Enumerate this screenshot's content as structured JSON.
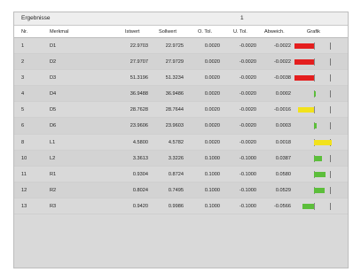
{
  "panel": {
    "title": "Ergebnisse",
    "page_number": "1"
  },
  "columns": {
    "nr": "Nr.",
    "merkmal": "Merkmal",
    "istwert": "Istwert",
    "sollwert": "Sollwert",
    "o_tol": "O. Tol.",
    "u_tol": "U. Tol.",
    "abweich": "Abweich.",
    "grafik": "Grafik"
  },
  "rows": [
    {
      "nr": "1",
      "merkmal": "D1",
      "istwert": "22.9703",
      "sollwert": "22.9725",
      "o_tol": "0.0020",
      "u_tol": "-0.0020",
      "abweich": "-0.0022",
      "status": "red",
      "direction": "left",
      "fill": 1.0
    },
    {
      "nr": "2",
      "merkmal": "D2",
      "istwert": "27.9707",
      "sollwert": "27.9729",
      "o_tol": "0.0020",
      "u_tol": "-0.0020",
      "abweich": "-0.0022",
      "status": "red",
      "direction": "left",
      "fill": 1.0
    },
    {
      "nr": "3",
      "merkmal": "D3",
      "istwert": "51.3196",
      "sollwert": "51.3234",
      "o_tol": "0.0020",
      "u_tol": "-0.0020",
      "abweich": "-0.0038",
      "status": "red",
      "direction": "left",
      "fill": 1.0
    },
    {
      "nr": "4",
      "merkmal": "D4",
      "istwert": "36.9488",
      "sollwert": "36.9486",
      "o_tol": "0.0020",
      "u_tol": "-0.0020",
      "abweich": "0.0002",
      "status": "green",
      "direction": "right",
      "fill": 0.1
    },
    {
      "nr": "5",
      "merkmal": "D5",
      "istwert": "28.7628",
      "sollwert": "28.7644",
      "o_tol": "0.0020",
      "u_tol": "-0.0020",
      "abweich": "-0.0016",
      "status": "yellow",
      "direction": "left",
      "fill": 0.8
    },
    {
      "nr": "6",
      "merkmal": "D6",
      "istwert": "23.9606",
      "sollwert": "23.9603",
      "o_tol": "0.0020",
      "u_tol": "-0.0020",
      "abweich": "0.0003",
      "status": "green",
      "direction": "right",
      "fill": 0.15
    },
    {
      "nr": "8",
      "merkmal": "L1",
      "istwert": "4.5800",
      "sollwert": "4.5782",
      "o_tol": "0.0020",
      "u_tol": "-0.0020",
      "abweich": "0.0018",
      "status": "yellow",
      "direction": "right",
      "fill": 0.9
    },
    {
      "nr": "10",
      "merkmal": "L2",
      "istwert": "3.3613",
      "sollwert": "3.3226",
      "o_tol": "0.1000",
      "u_tol": "-0.1000",
      "abweich": "0.0387",
      "status": "green",
      "direction": "right",
      "fill": 0.39
    },
    {
      "nr": "11",
      "merkmal": "R1",
      "istwert": "0.9304",
      "sollwert": "0.8724",
      "o_tol": "0.1000",
      "u_tol": "-0.1000",
      "abweich": "0.0580",
      "status": "green",
      "direction": "right",
      "fill": 0.58
    },
    {
      "nr": "12",
      "merkmal": "R2",
      "istwert": "0.8024",
      "sollwert": "0.7495",
      "o_tol": "0.1000",
      "u_tol": "-0.1000",
      "abweich": "0.0529",
      "status": "green",
      "direction": "right",
      "fill": 0.53
    },
    {
      "nr": "13",
      "merkmal": "R3",
      "istwert": "0.9420",
      "sollwert": "0.9986",
      "o_tol": "0.1000",
      "u_tol": "-0.1000",
      "abweich": "-0.0566",
      "status": "green",
      "direction": "left",
      "fill": 0.57
    }
  ],
  "colors": {
    "red": "#e41e1e",
    "yellow": "#f2e21c",
    "green": "#5cbe3b"
  }
}
